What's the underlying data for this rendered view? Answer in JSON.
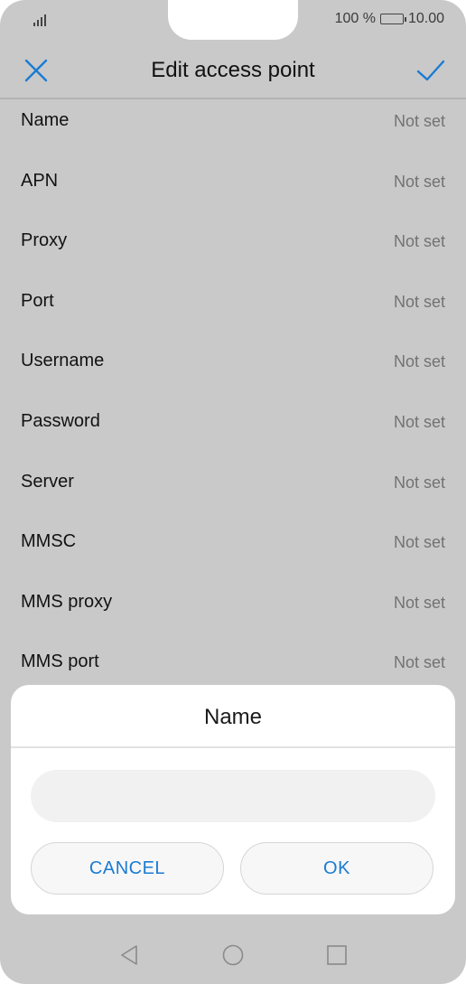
{
  "status_bar": {
    "battery_text": "100 %",
    "time": "10.00",
    "battery_level": 1.0
  },
  "app_bar": {
    "title": "Edit access point",
    "close_icon": "close-icon",
    "confirm_icon": "check-icon"
  },
  "settings": [
    {
      "label": "Name",
      "value": "Not set"
    },
    {
      "label": "APN",
      "value": "Not set"
    },
    {
      "label": "Proxy",
      "value": "Not set"
    },
    {
      "label": "Port",
      "value": "Not set"
    },
    {
      "label": "Username",
      "value": "Not set"
    },
    {
      "label": "Password",
      "value": "Not set"
    },
    {
      "label": "Server",
      "value": "Not set"
    },
    {
      "label": "MMSC",
      "value": "Not set"
    },
    {
      "label": "MMS proxy",
      "value": "Not set"
    },
    {
      "label": "MMS port",
      "value": "Not set"
    }
  ],
  "dialog": {
    "title": "Name",
    "input_value": "",
    "input_placeholder": "",
    "cancel_label": "CANCEL",
    "ok_label": "OK"
  },
  "nav_bar": {
    "back_icon": "back-triangle-icon",
    "home_icon": "home-circle-icon",
    "recents_icon": "recents-square-icon"
  },
  "colors": {
    "accent": "#1a7bd3",
    "overlay_background": "#c9c9c9",
    "secondary_text": "#727272"
  }
}
